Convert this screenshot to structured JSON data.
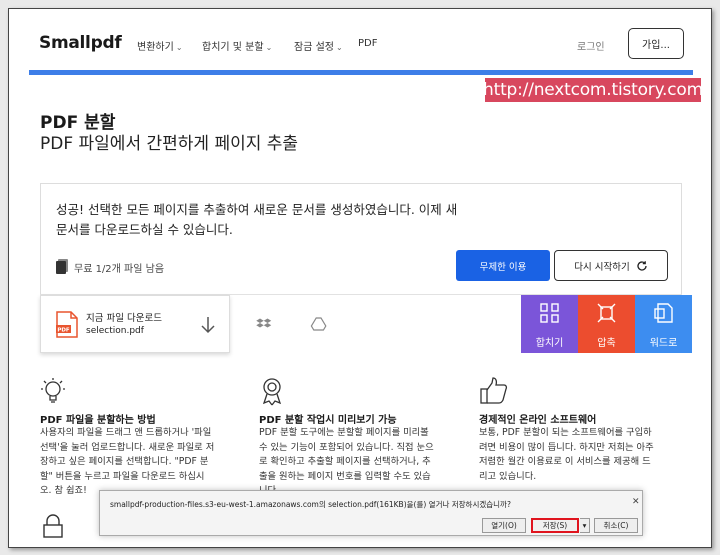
{
  "header": {
    "logo": "Smallpdf",
    "nav": [
      {
        "label": "변환하기"
      },
      {
        "label": "합치기 및 분할"
      },
      {
        "label": "잠금 설정"
      },
      {
        "label": "PDF"
      }
    ],
    "login": "로그인",
    "signup": "가입..."
  },
  "watermark": "http://nextcom.tistory.com",
  "page": {
    "title": "PDF 분할",
    "subtitle": "PDF 파일에서 간편하게 페이지 추출"
  },
  "result": {
    "message_line1": "성공! 선택한 모든 페이지를 추출하여 새로운 문서를 생성하였습니다. 이제 새",
    "message_line2": "문서를 다운로드하실 수 있습니다.",
    "quota": "무료 1/2개 파일 남음",
    "unlimited_button": "무제한 이용",
    "restart_button": "다시 시작하기"
  },
  "download": {
    "title": "지금 파일 다운로드",
    "filename": "selection.pdf",
    "pdf_badge": "PDF"
  },
  "tools": [
    {
      "label": "합치기",
      "color": "#7b55d9",
      "icon": "merge-icon"
    },
    {
      "label": "압축",
      "color": "#ec4d2f",
      "icon": "compress-icon"
    },
    {
      "label": "워드로",
      "color": "#3d8df0",
      "icon": "word-icon"
    }
  ],
  "features": [
    {
      "title": "PDF 파일을 분할하는 방법",
      "lines": [
        "사용자의 파일을 드래그 앤 드롭하거나 '파일",
        "선택'을 눌러 업로드합니다. 새로운 파일로 저",
        "장하고 싶은 페이지를 선택합니다. \"PDF 분",
        "할\" 버튼을 누르고 파일을 다운로드 하십시",
        "오. 참 쉽죠!"
      ]
    },
    {
      "title": "PDF 분할 작업시 미리보기 가능",
      "lines": [
        "PDF 분할 도구에는 분할할 페이지를 미리볼",
        "수 있는 기능이 포함되어 있습니다. 직접 눈으",
        "로 확인하고 추출할 페이지를 선택하거나, 추",
        "출을 원하는 페이지 번호를 입력할 수도 있습",
        "니다."
      ]
    },
    {
      "title": "경제적인 온라인 소프트웨어",
      "lines": [
        "보통, PDF 분할이 되는 소프트웨어를 구입하",
        "려면 비용이 많이 듭니다. 하지만 저희는 아주",
        "저렴한 월간 이용료로 이 서비스를 제공해 드",
        "리고 있습니다."
      ]
    }
  ],
  "dialog": {
    "message": "smallpdf-production-files.s3-eu-west-1.amazonaws.com의 selection.pdf(161KB)을(를) 열거나 저장하시겠습니까?",
    "open": "열기(O)",
    "save": "저장(S)",
    "cancel": "취소(C)",
    "dropdown_arrow": "▾",
    "close": "✕"
  }
}
